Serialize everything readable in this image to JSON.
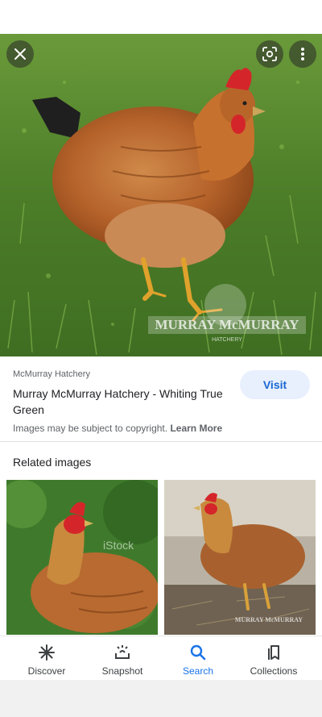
{
  "viewer": {
    "close_icon": "close-icon",
    "lens_icon": "lens-icon",
    "more_icon": "more-vert-icon",
    "hero_watermark": "MURRAY McMURRAY",
    "hero_watermark_sub": "HATCHERY"
  },
  "result": {
    "source": "McMurray Hatchery",
    "title": "Murray McMurray Hatchery - Whiting True Green",
    "visit_label": "Visit",
    "copyright_text": "Images may be subject to copyright. ",
    "learn_more_label": "Learn More"
  },
  "related": {
    "heading": "Related images",
    "thumb_watermark_1": "iStock",
    "thumb_watermark_2": "MURRAY McMURRAY"
  },
  "bottom_nav": {
    "items": [
      {
        "label": "Discover",
        "icon": "asterisk-icon"
      },
      {
        "label": "Snapshot",
        "icon": "snapshot-icon"
      },
      {
        "label": "Search",
        "icon": "search-icon",
        "active": true
      },
      {
        "label": "Collections",
        "icon": "collections-icon"
      }
    ]
  },
  "colors": {
    "accent": "#1a73e8",
    "visit_bg": "#e8f0fe",
    "grass": "#4f8a2c",
    "hen": "#b5622a"
  }
}
